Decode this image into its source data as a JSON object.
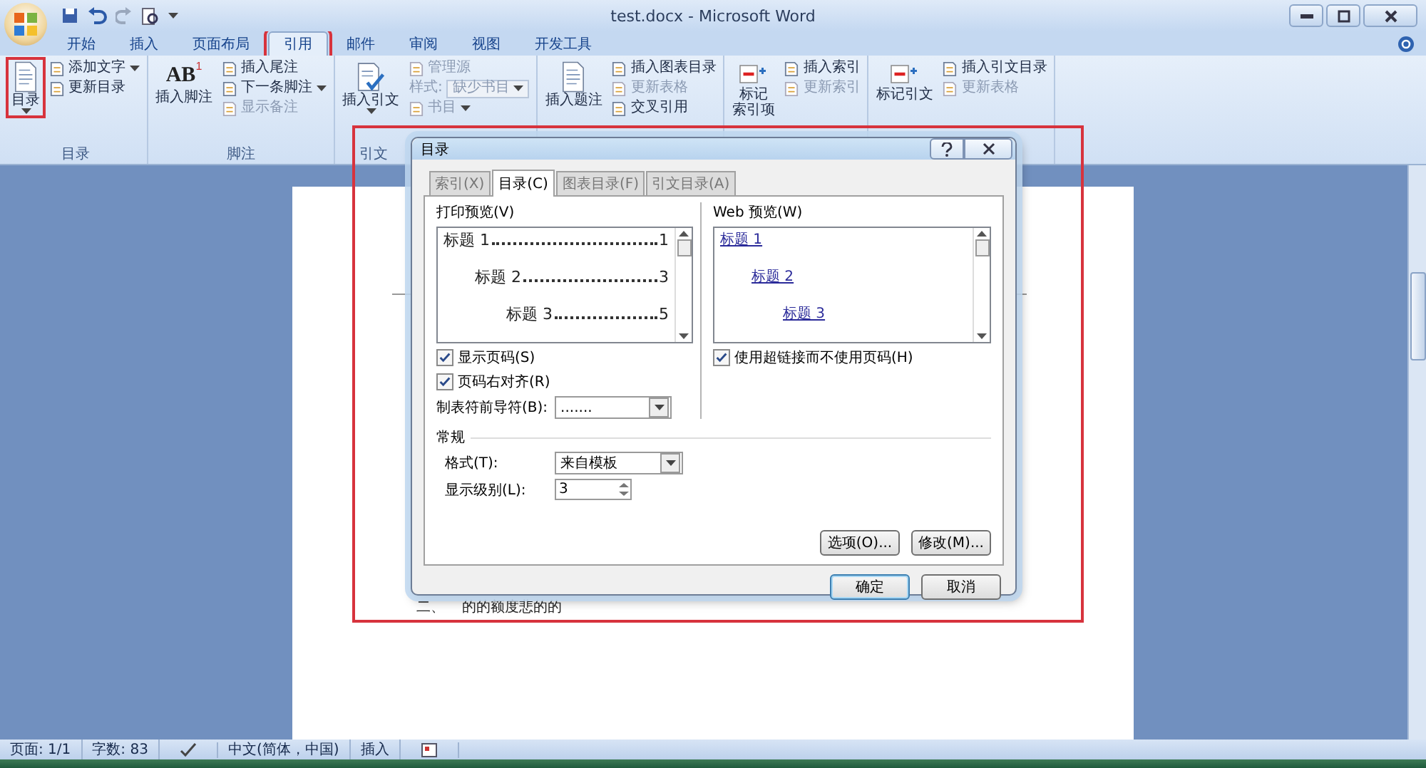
{
  "window": {
    "title": "test.docx - Microsoft Word"
  },
  "ribbon_tabs": [
    {
      "label": "开始",
      "selected": false,
      "highlighted": false
    },
    {
      "label": "插入",
      "selected": false,
      "highlighted": false
    },
    {
      "label": "页面布局",
      "selected": false,
      "highlighted": false
    },
    {
      "label": "引用",
      "selected": true,
      "highlighted": true
    },
    {
      "label": "邮件",
      "selected": false,
      "highlighted": false
    },
    {
      "label": "审阅",
      "selected": false,
      "highlighted": false
    },
    {
      "label": "视图",
      "selected": false,
      "highlighted": false
    },
    {
      "label": "开发工具",
      "selected": false,
      "highlighted": false
    }
  ],
  "ribbon_groups": [
    {
      "label": "目录",
      "large": [
        {
          "label_lines": [
            "目录"
          ],
          "dropdown": true,
          "highlighted": true
        }
      ],
      "small": [
        {
          "kind": "button",
          "label": "添加文字",
          "dropdown": true,
          "disabled": false
        },
        {
          "kind": "button",
          "label": "更新目录",
          "dropdown": false,
          "disabled": false
        }
      ]
    },
    {
      "label": "脚注",
      "large": [
        {
          "label_lines": [
            "插入脚注"
          ],
          "icon_text": "AB",
          "icon_superscript": "1",
          "dropdown": false,
          "highlighted": false
        }
      ],
      "small": [
        {
          "kind": "button",
          "label": "插入尾注",
          "dropdown": false,
          "disabled": false
        },
        {
          "kind": "button",
          "label": "下一条脚注",
          "dropdown": true,
          "disabled": false
        },
        {
          "kind": "button",
          "label": "显示备注",
          "dropdown": false,
          "disabled": true
        }
      ]
    },
    {
      "label": "引文",
      "large": [
        {
          "label_lines": [
            "插入引文"
          ],
          "dropdown": true,
          "highlighted": false
        }
      ],
      "small": [
        {
          "kind": "button",
          "label": "管理源",
          "dropdown": false,
          "disabled": true
        },
        {
          "kind": "combo",
          "label": "样式:",
          "value": "缺少书目",
          "disabled": true
        },
        {
          "kind": "button",
          "label": "书目",
          "dropdown": true,
          "disabled": true
        }
      ]
    },
    {
      "large": [
        {
          "label_lines": [
            "插入题注"
          ],
          "dropdown": false,
          "highlighted": false
        }
      ],
      "small": [
        {
          "kind": "button",
          "label": "插入图表目录",
          "dropdown": false,
          "disabled": false
        },
        {
          "kind": "button",
          "label": "更新表格",
          "dropdown": false,
          "disabled": true
        },
        {
          "kind": "button",
          "label": "交叉引用",
          "dropdown": false,
          "disabled": false
        }
      ]
    },
    {
      "large": [
        {
          "label_lines": [
            "标记",
            "索引项"
          ],
          "dropdown": false,
          "highlighted": false
        }
      ],
      "small": [
        {
          "kind": "button",
          "label": "插入索引",
          "dropdown": false,
          "disabled": false
        },
        {
          "kind": "button",
          "label": "更新索引",
          "dropdown": false,
          "disabled": true
        }
      ]
    },
    {
      "large": [
        {
          "label_lines": [
            "标记引文"
          ],
          "dropdown": false,
          "highlighted": false
        }
      ],
      "small": [
        {
          "kind": "button",
          "label": "插入引文目录",
          "dropdown": false,
          "disabled": false
        },
        {
          "kind": "button",
          "label": "更新表格",
          "dropdown": false,
          "disabled": true
        }
      ]
    }
  ],
  "document": {
    "list_marker": "二、",
    "text": "的的额度悲的的"
  },
  "dialog": {
    "title": "目录",
    "highlighted": true,
    "tabs": [
      {
        "label": "索引(X)",
        "selected": false
      },
      {
        "label": "目录(C)",
        "selected": true
      },
      {
        "label": "图表目录(F)",
        "selected": false
      },
      {
        "label": "引文目录(A)",
        "selected": false
      }
    ],
    "print_preview": {
      "label": "打印预览(V)",
      "entries": [
        {
          "text": "标题 1",
          "page": "1",
          "children": [
            {
              "text": "标题 2",
              "page": "3",
              "children": [
                {
                  "text": "标题 3",
                  "page": "5"
                }
              ]
            }
          ]
        }
      ]
    },
    "web_preview": {
      "label": "Web 预览(W)",
      "entries": [
        {
          "text": "标题 1",
          "children": [
            {
              "text": "标题 2",
              "children": [
                {
                  "text": "标题 3"
                }
              ]
            }
          ]
        }
      ]
    },
    "left_checkboxes": [
      {
        "label": "显示页码(S)",
        "checked": true
      },
      {
        "label": "页码右对齐(R)",
        "checked": true
      }
    ],
    "tab_leader": {
      "label": "制表符前导符(B):",
      "value": "......."
    },
    "right_checkboxes": [
      {
        "label": "使用超链接而不使用页码(H)",
        "checked": true
      }
    ],
    "general": {
      "title": "常规",
      "format": {
        "label": "格式(T):",
        "value": "来自模板"
      },
      "levels": {
        "label": "显示级别(L):",
        "value": "3"
      }
    },
    "panel_buttons": [
      "选项(O)...",
      "修改(M)..."
    ],
    "buttons": [
      {
        "label": "确定",
        "default": true
      },
      {
        "label": "取消",
        "default": false
      }
    ]
  },
  "status_bar": {
    "page": "页面: 1/1",
    "words": "字数: 83",
    "language": "中文(简体，中国)",
    "mode": "插入"
  }
}
